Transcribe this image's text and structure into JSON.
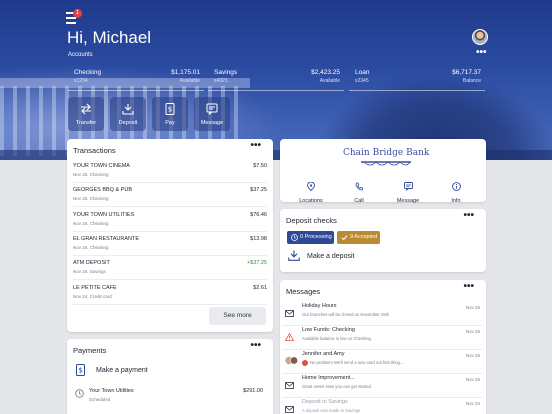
{
  "header": {
    "greeting": "Hi, Michael",
    "accounts_label": "Accounts",
    "menu_badge": "1",
    "more_glyph": "•••"
  },
  "accounts": [
    {
      "name": "Checking",
      "number": "x1234",
      "amount": "$1,175.01",
      "sub": "Available"
    },
    {
      "name": "Savings",
      "number": "x4321",
      "amount": "$2,423.25",
      "sub": "Available"
    },
    {
      "name": "Loan",
      "number": "x2345",
      "amount": "$6,717.37",
      "sub": "Balance"
    }
  ],
  "quick_actions": [
    {
      "label": "Transfer",
      "icon": "transfer-icon"
    },
    {
      "label": "Deposit",
      "icon": "deposit-icon"
    },
    {
      "label": "Pay",
      "icon": "pay-icon"
    },
    {
      "label": "Message",
      "icon": "message-icon"
    }
  ],
  "transactions": {
    "title": "Transactions",
    "items": [
      {
        "name": "YOUR TOWN CINEMA",
        "detail": "Nov 25, Checking",
        "amount": "$7.50",
        "positive": false
      },
      {
        "name": "GEORGES BBQ & PUB",
        "detail": "Nov 25, Checking",
        "amount": "$37.25",
        "positive": false
      },
      {
        "name": "YOUR TOWN UTILITIES",
        "detail": "Nov 25, Checking",
        "amount": "$76.46",
        "positive": false
      },
      {
        "name": "EL GRAN RESTAURANTE",
        "detail": "Nov 25, Checking",
        "amount": "$13.98",
        "positive": false
      },
      {
        "name": "ATM DEPOSIT",
        "detail": "Nov 25, Savings",
        "amount": "+$37.25",
        "positive": true
      },
      {
        "name": "LE PETITE CAFE",
        "detail": "Nov 24, Credit card",
        "amount": "$2.61",
        "positive": false
      }
    ],
    "see_more": "See more"
  },
  "payments": {
    "title": "Payments",
    "make_payment": "Make a payment",
    "scheduled": {
      "name": "Your Town Utilities",
      "status": "Scheduled",
      "amount": "$291.00"
    }
  },
  "bank": {
    "name": "Chain Bridge Bank",
    "links": [
      {
        "label": "Locations",
        "icon": "location-pin-icon"
      },
      {
        "label": "Call",
        "icon": "phone-icon"
      },
      {
        "label": "Message",
        "icon": "message-icon"
      },
      {
        "label": "Info",
        "icon": "info-icon"
      }
    ]
  },
  "deposit_checks": {
    "title": "Deposit checks",
    "processing": "0 Processing",
    "accepted": "9 Accepted",
    "make_deposit": "Make a deposit"
  },
  "messages": {
    "title": "Messages",
    "items": [
      {
        "title": "Holiday Hours",
        "desc": "Our branches will be closed on November 25th",
        "date": "Nov 25",
        "icon": "envelope-icon",
        "muted": false
      },
      {
        "title": "Low Funds: Checking",
        "desc": "Available balance is low on Checking.",
        "date": "Nov 25",
        "icon": "warning-icon",
        "muted": false
      },
      {
        "title": "Jennifer and Amy",
        "desc": "No problem! We'll send a new card out first thing...",
        "date": "Nov 25",
        "icon": "group-avatar-icon",
        "muted": false
      },
      {
        "title": "Home Improvement...",
        "desc": "Great news! Now you can get started",
        "date": "Nov 25",
        "icon": "envelope-icon",
        "muted": false
      },
      {
        "title": "Deposit to Savings",
        "desc": "A deposit was made to Savings",
        "date": "Nov 23",
        "icon": "envelope-icon",
        "muted": true
      }
    ]
  },
  "colors": {
    "brand": "#2e4a97",
    "accent_gold": "#b98a2e",
    "positive": "#3c8f3c",
    "warning": "#d9533c"
  }
}
